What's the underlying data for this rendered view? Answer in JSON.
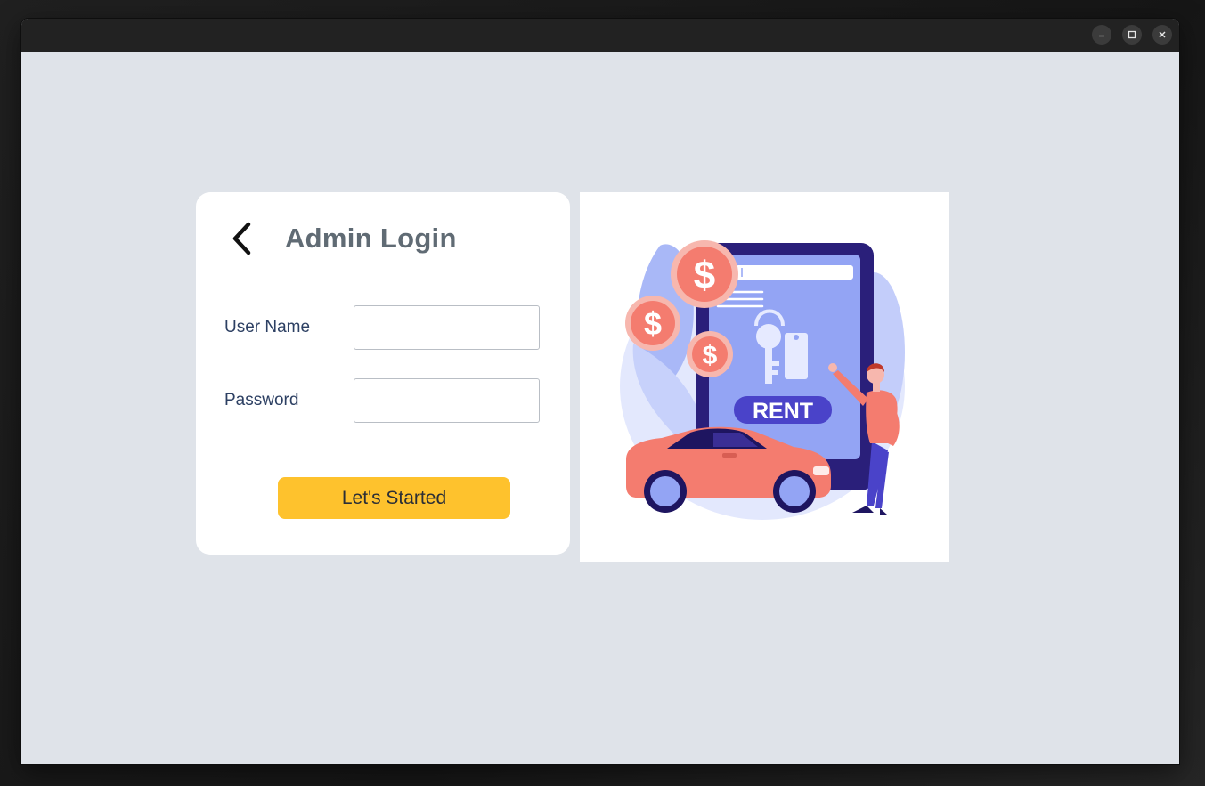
{
  "window": {
    "controls": {
      "minimize_icon": "minimize-icon",
      "maximize_icon": "maximize-icon",
      "close_icon": "close-icon"
    }
  },
  "login": {
    "title": "Admin Login",
    "back_icon": "chevron-left-icon",
    "username_label": "User Name",
    "username_value": "",
    "password_label": "Password",
    "password_value": "",
    "submit_label": "Let's Started"
  },
  "illustration": {
    "sign_text": "RENT",
    "coin_symbol": "$"
  },
  "colors": {
    "accent": "#fec22d",
    "title": "#606b74",
    "label": "#2d4063",
    "background": "#dfe3e9",
    "coral": "#f47c6f",
    "indigo": "#2a1f7a",
    "periwinkle": "#93a4f4"
  }
}
